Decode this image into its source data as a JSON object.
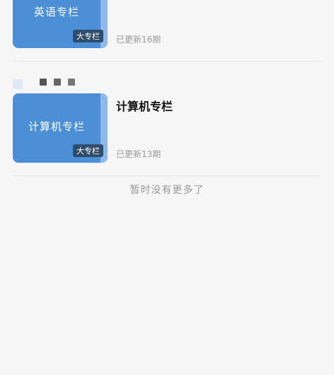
{
  "columns": [
    {
      "cover_text": "英语专栏",
      "badge": "大专栏",
      "update": "已更新16期"
    },
    {
      "title": "计算机专栏",
      "cover_text": "计算机专栏",
      "badge": "大专栏",
      "update": "已更新13期"
    }
  ],
  "list_footer": "暂时没有更多了",
  "colors": {
    "cover": "#4d8fd6",
    "badge": "#2f4c6b",
    "background": "#f6f6f6",
    "muted_text": "#999999"
  }
}
